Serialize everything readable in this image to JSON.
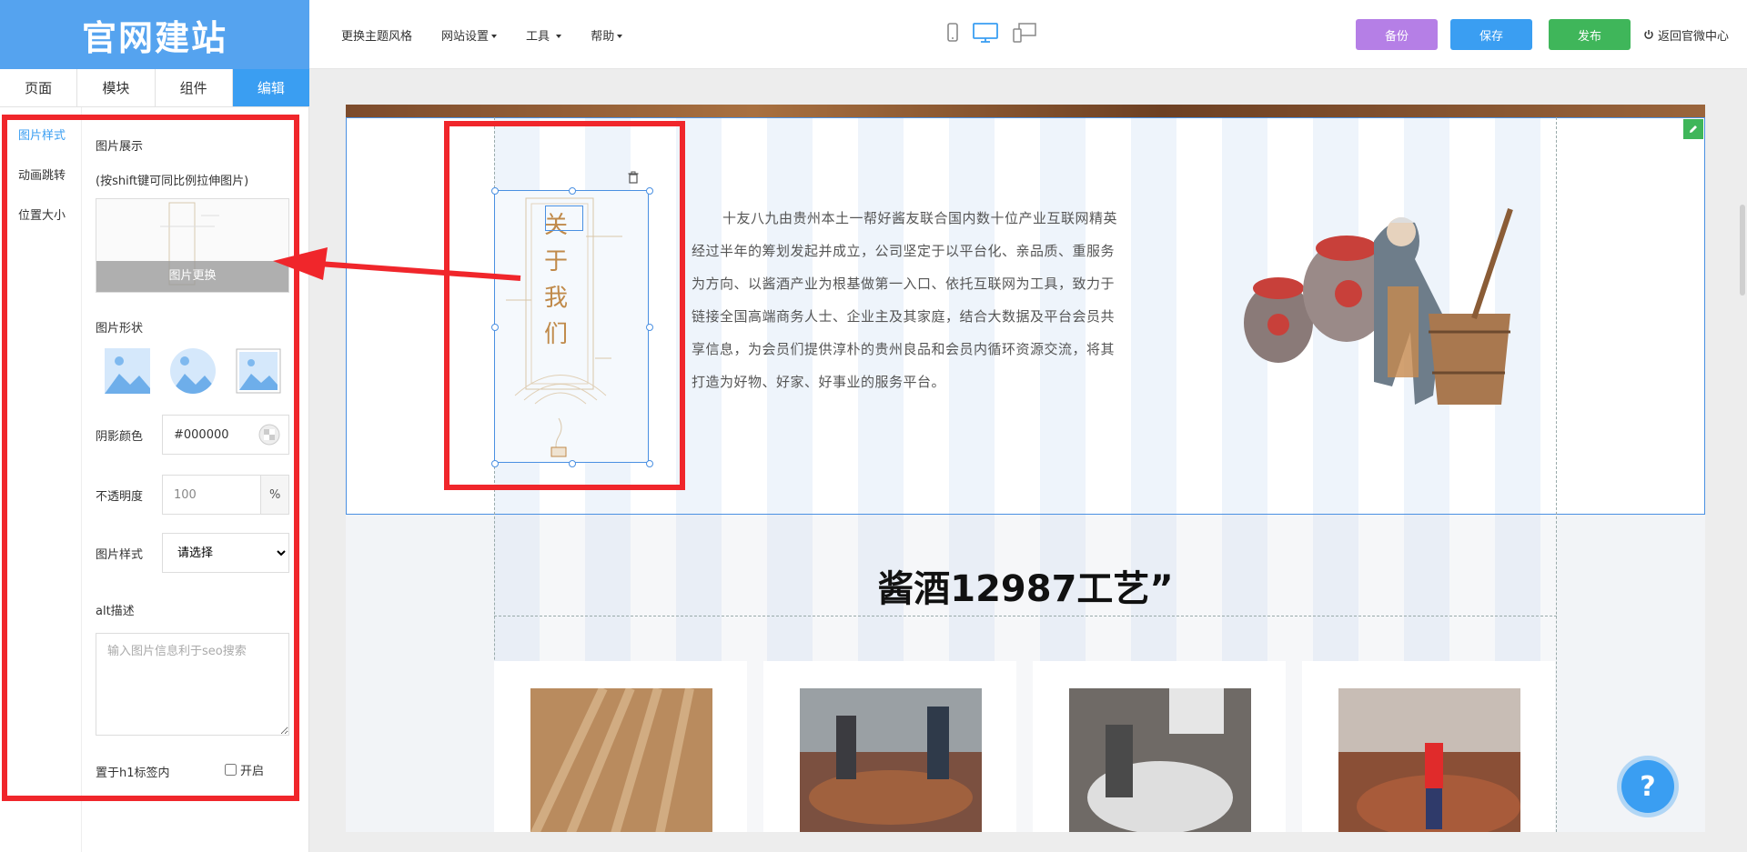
{
  "app": {
    "logo": "官网建站"
  },
  "topmenu": {
    "theme": "更换主题风格",
    "settings": "网站设置",
    "tools": "工具",
    "help": "帮助"
  },
  "actions": {
    "backup": "备份",
    "save": "保存",
    "publish": "发布",
    "return": "返回官微中心"
  },
  "tabs": [
    {
      "label": "页面"
    },
    {
      "label": "模块"
    },
    {
      "label": "组件"
    },
    {
      "label": "编辑"
    }
  ],
  "subnav": [
    {
      "label": "图片样式"
    },
    {
      "label": "动画跳转"
    },
    {
      "label": "位置大小"
    }
  ],
  "props": {
    "image_display": "图片展示",
    "shift_hint": "(按shift键可同比例拉伸图片)",
    "replace": "图片更换",
    "image_shape": "图片形状",
    "shadow_label": "阴影颜色",
    "shadow_value": "#000000",
    "opacity_label": "不透明度",
    "opacity_value": "100",
    "opacity_unit": "%",
    "style_label": "图片样式",
    "style_selected": "请选择",
    "alt_label": "alt描述",
    "alt_placeholder": "输入图片信息利于seo搜索",
    "h1_label": "置于h1标签内",
    "h1_toggle": "开启"
  },
  "canvas": {
    "about_title": [
      "关",
      "于",
      "我",
      "们"
    ],
    "about_text": "十友八九由贵州本土一帮好酱友联合国内数十位产业互联网精英经过半年的筹划发起并成立，公司坚定于以平台化、亲品质、重服务为方向、以酱酒产业为根基做第一入口、依托互联网为工具，致力于链接全国高端商务人士、企业主及其家庭，结合大数据及平台会员共享信息，为会员们提供淳朴的贵州良品和会员内循环资源交流，将其打造为好物、好家、好事业的服务平台。",
    "section_title": "酱酒12987工艺”"
  },
  "colors": {
    "accent": "#3a9ef2",
    "logo_bg": "#55a3ef",
    "backup": "#b57fe6",
    "publish": "#3fb65a",
    "highlight": "#f0262b"
  }
}
